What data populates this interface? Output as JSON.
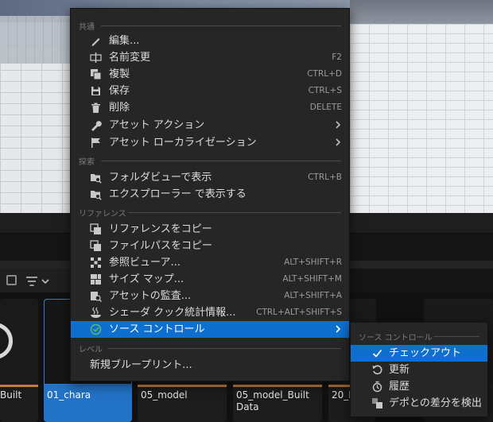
{
  "context_menu": {
    "sections": {
      "common": "共通",
      "explore": "探索",
      "references": "リファレンス",
      "level": "レベル"
    },
    "items": {
      "edit": {
        "label": "編集...",
        "shortcut": ""
      },
      "rename": {
        "label": "名前変更",
        "shortcut": "F2"
      },
      "duplicate": {
        "label": "複製",
        "shortcut": "CTRL+D"
      },
      "save": {
        "label": "保存",
        "shortcut": "CTRL+S"
      },
      "delete": {
        "label": "削除",
        "shortcut": "DELETE"
      },
      "asset_actions": {
        "label": "アセット アクション"
      },
      "asset_localization": {
        "label": "アセット ローカライゼーション"
      },
      "show_in_folder_view": {
        "label": "フォルダビューで表示",
        "shortcut": "CTRL+B"
      },
      "show_in_explorer": {
        "label": "エクスプローラー で表示する",
        "shortcut": ""
      },
      "copy_reference": {
        "label": "リファレンスをコピー",
        "shortcut": ""
      },
      "copy_file_path": {
        "label": "ファイルパスをコピー",
        "shortcut": ""
      },
      "reference_viewer": {
        "label": "参照ビューア...",
        "shortcut": "ALT+SHIFT+R"
      },
      "size_map": {
        "label": "サイズ マップ...",
        "shortcut": "ALT+SHIFT+M"
      },
      "asset_audit": {
        "label": "アセットの監査...",
        "shortcut": "ALT+SHIFT+A"
      },
      "shader_cook_stats": {
        "label": "シェーダ クック統計情報...",
        "shortcut": "CTRL+ALT+SHIFT+S"
      },
      "source_control": {
        "label": "ソース コントロール"
      },
      "new_blueprint": {
        "label": "新規ブループリント..."
      }
    }
  },
  "submenu": {
    "section": "ソース コントロール",
    "items": {
      "check_out": "チェックアウト",
      "refresh": "更新",
      "history": "履歴",
      "diff_against_depot": "デポとの差分を検出"
    }
  },
  "tiles": [
    {
      "label": "Built"
    },
    {
      "label": "01_chara"
    },
    {
      "label": "05_model"
    },
    {
      "label": "05_model_Built Data"
    },
    {
      "label": "20_E"
    }
  ],
  "colors": {
    "menu_bg": "#262626",
    "highlight": "#0e6fcf",
    "tile_accent": "#c87c3a",
    "tile_selected": "#2273c7"
  }
}
